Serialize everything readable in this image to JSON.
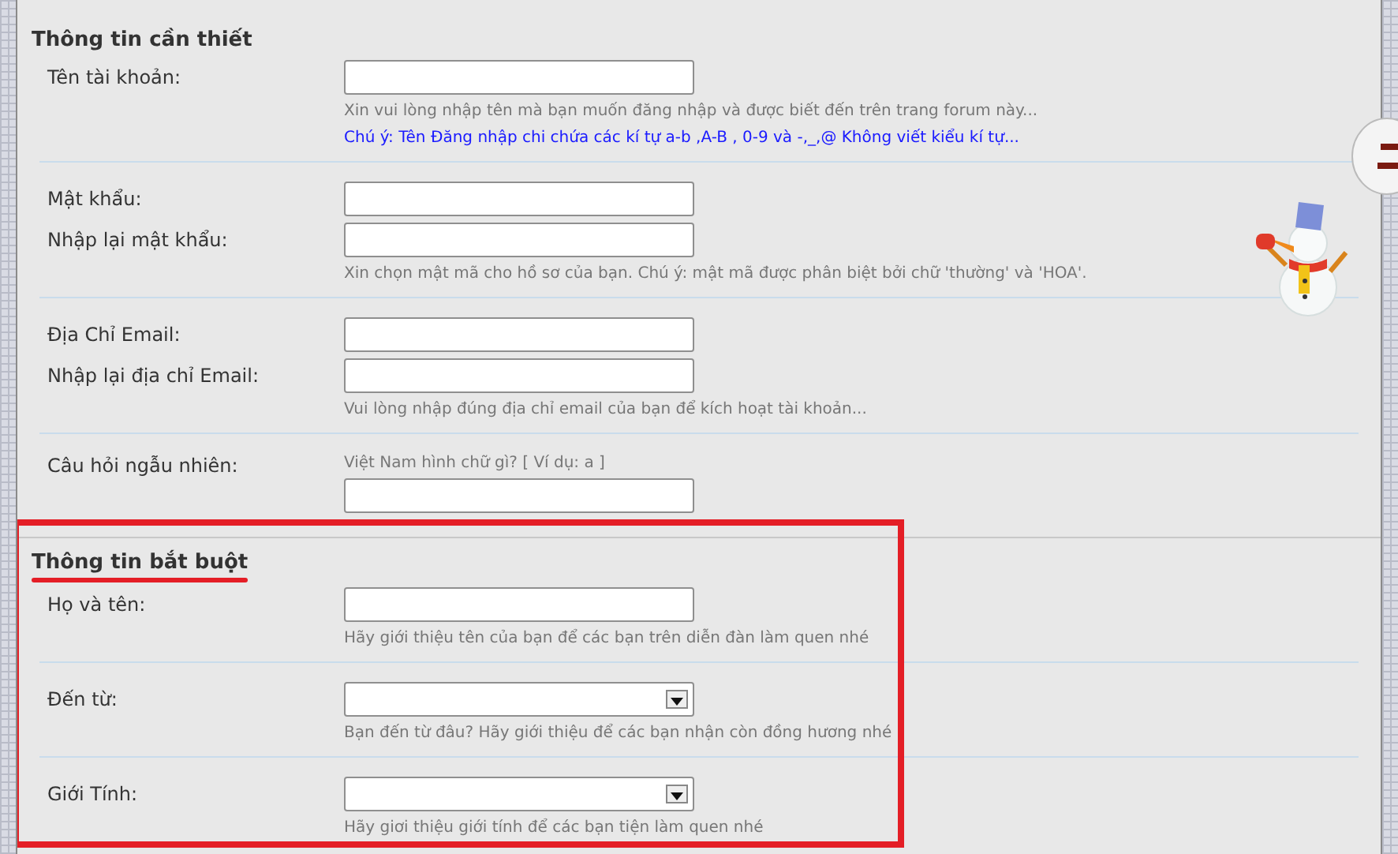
{
  "sections": [
    {
      "title": "Thông tin cần thiết",
      "underlined": false,
      "highlighted": false,
      "groups": [
        {
          "items": [
            {
              "kind": "field",
              "label": "Tên tài khoản:",
              "input": {
                "kind": "text"
              }
            },
            {
              "kind": "hint",
              "text": "Xin vui lòng nhập tên mà bạn muốn đăng nhập và được biết đến trên trang forum này..."
            },
            {
              "kind": "note",
              "text": "Chú ý: Tên Đăng nhập chi chứa các kí tự a-b ,A-B , 0-9 và -,_,@ Không viết kiểu kí tự..."
            }
          ]
        },
        {
          "items": [
            {
              "kind": "field",
              "label": "Mật khẩu:",
              "input": {
                "kind": "text"
              }
            },
            {
              "kind": "field",
              "label": "Nhập lại mật khẩu:",
              "input": {
                "kind": "text"
              }
            },
            {
              "kind": "hint",
              "text": "Xin chọn mật mã cho hồ sơ của bạn. Chú ý: mật mã được phân biệt bởi chữ 'thường' và 'HOA'."
            }
          ]
        },
        {
          "items": [
            {
              "kind": "field",
              "label": "Địa Chỉ Email:",
              "input": {
                "kind": "text"
              }
            },
            {
              "kind": "field",
              "label": "Nhập lại địa chỉ Email:",
              "input": {
                "kind": "text"
              }
            },
            {
              "kind": "hint",
              "text": "Vui lòng nhập đúng địa chỉ email của bạn để kích hoạt tài khoản..."
            }
          ]
        },
        {
          "items": [
            {
              "kind": "field",
              "label": "Câu hỏi ngẫu nhiên:",
              "prompt": "Việt Nam hình chữ gì? [ Ví dụ: a ]",
              "input": {
                "kind": "text"
              }
            }
          ]
        }
      ]
    },
    {
      "title": "Thông tin bắt buột",
      "underlined": true,
      "highlighted": true,
      "groups": [
        {
          "items": [
            {
              "kind": "field",
              "label": "Họ và tên:",
              "input": {
                "kind": "text"
              }
            },
            {
              "kind": "hint",
              "text": "Hãy giới thiệu tên của bạn để các bạn trên diễn đàn làm quen nhé"
            }
          ]
        },
        {
          "items": [
            {
              "kind": "field",
              "label": "Đến từ:",
              "input": {
                "kind": "select"
              }
            },
            {
              "kind": "hint",
              "text": "Bạn đến từ đâu? Hãy giới thiệu để các bạn nhận còn đồng hương nhé"
            }
          ]
        },
        {
          "items": [
            {
              "kind": "field",
              "label": "Giới Tính:",
              "input": {
                "kind": "select"
              }
            },
            {
              "kind": "hint",
              "text": "Hãy giơi thiệu giới tính để các bạn tiện làm quen nhé"
            }
          ]
        }
      ]
    }
  ]
}
